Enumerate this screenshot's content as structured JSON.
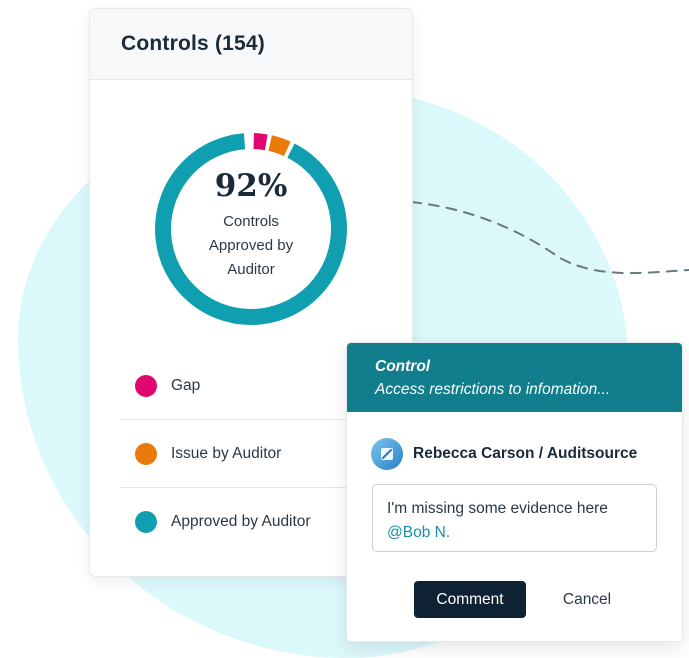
{
  "colors": {
    "gap": "#e1066f",
    "issue": "#ea7a0a",
    "approved": "#0f9fb1",
    "header_teal": "#107e8c",
    "button_dark": "#0f2233",
    "mention": "#1a8fa3"
  },
  "controls_card": {
    "title": "Controls (154)",
    "donut": {
      "percent_label": "92%",
      "caption": "Controls Approved by Auditor",
      "segments": [
        {
          "name": "Gap",
          "fraction": 0.03,
          "color": "#e1066f"
        },
        {
          "name": "Issue by Auditor",
          "fraction": 0.04,
          "color": "#ea7a0a"
        },
        {
          "name": "Approved by Auditor",
          "fraction": 0.92,
          "color": "#0f9fb1"
        }
      ]
    },
    "legend": [
      {
        "label": "Gap",
        "color": "#e1066f"
      },
      {
        "label": "Issue by Auditor",
        "color": "#ea7a0a"
      },
      {
        "label": "Approved by Auditor",
        "color": "#0f9fb1"
      }
    ]
  },
  "comment_card": {
    "title": "Control",
    "subtitle": "Access restrictions to infomation...",
    "author": "Rebecca Carson / Auditsource",
    "avatar_icon": "auditsource-logo-icon",
    "comment_text": "I'm missing some evidence here",
    "mention": "@Bob N.",
    "comment_button": "Comment",
    "cancel_button": "Cancel"
  }
}
